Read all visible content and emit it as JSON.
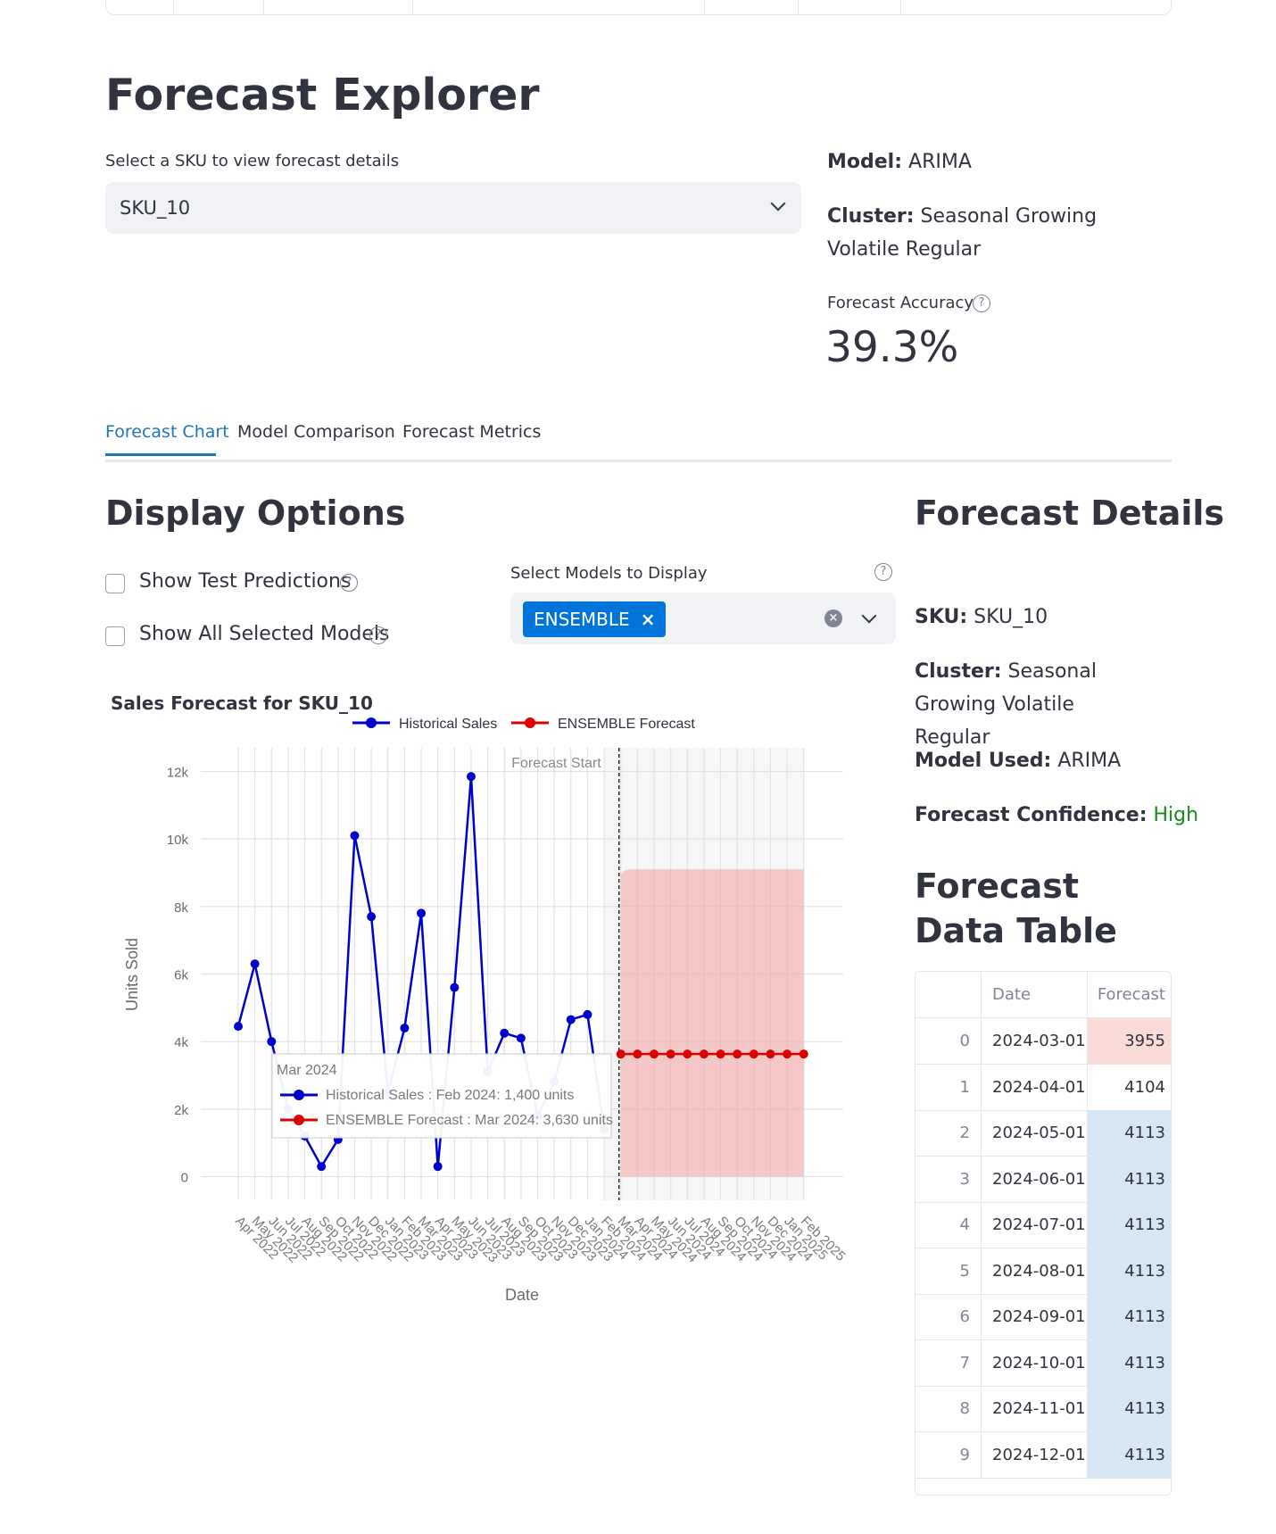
{
  "page": {
    "title": "Forecast Explorer"
  },
  "sku_select": {
    "label": "Select a SKU to view forecast details",
    "value": "SKU_10"
  },
  "summary": {
    "model_label": "Model:",
    "model_value": "ARIMA",
    "cluster_label": "Cluster:",
    "cluster_value": "Seasonal Growing Volatile Regular",
    "accuracy_label": "Forecast Accuracy",
    "accuracy_value": "39.3%"
  },
  "tabs": [
    {
      "label": "Forecast Chart",
      "active": true
    },
    {
      "label": "Model Comparison",
      "active": false
    },
    {
      "label": "Forecast Metrics",
      "active": false
    }
  ],
  "display_options": {
    "heading": "Display Options",
    "show_test_predictions": {
      "label": "Show Test Predictions",
      "checked": false
    },
    "show_all_models": {
      "label": "Show All Selected Models",
      "checked": false
    },
    "models_label": "Select Models to Display",
    "selected_models": [
      "ENSEMBLE"
    ]
  },
  "details": {
    "heading": "Forecast Details",
    "sku_label": "SKU:",
    "sku_value": "SKU_10",
    "cluster_label": "Cluster:",
    "cluster_value": "Seasonal Growing Volatile Regular",
    "model_label": "Model Used:",
    "model_value": "ARIMA",
    "confidence_label": "Forecast Confidence:",
    "confidence_value": "High",
    "confidence_color": "#1a8a1a"
  },
  "data_table": {
    "heading": "Forecast Data Table",
    "columns": [
      "",
      "Date",
      "Forecast"
    ],
    "rows": [
      {
        "index": "0",
        "date": "2024-03-01",
        "forecast": "3955"
      },
      {
        "index": "1",
        "date": "2024-04-01",
        "forecast": "4104"
      },
      {
        "index": "2",
        "date": "2024-05-01",
        "forecast": "4113"
      },
      {
        "index": "3",
        "date": "2024-06-01",
        "forecast": "4113"
      },
      {
        "index": "4",
        "date": "2024-07-01",
        "forecast": "4113"
      },
      {
        "index": "5",
        "date": "2024-08-01",
        "forecast": "4113"
      },
      {
        "index": "6",
        "date": "2024-09-01",
        "forecast": "4113"
      },
      {
        "index": "7",
        "date": "2024-10-01",
        "forecast": "4113"
      },
      {
        "index": "8",
        "date": "2024-11-01",
        "forecast": "4113"
      },
      {
        "index": "9",
        "date": "2024-12-01",
        "forecast": "4113"
      }
    ],
    "colors": {
      "low": "#fadbd8",
      "mid": "#ffffff",
      "high": "#d6e6f4"
    }
  },
  "chart_data": {
    "type": "line",
    "title": "Sales Forecast for SKU_10",
    "xlabel": "Date",
    "ylabel": "Units Sold",
    "ylim": [
      -700,
      12700
    ],
    "yticks": [
      0,
      2000,
      4000,
      6000,
      8000,
      10000,
      12000
    ],
    "ytick_labels": [
      "0",
      "2k",
      "4k",
      "6k",
      "8k",
      "10k",
      "12k"
    ],
    "x": [
      "Apr 2022",
      "May 2022",
      "Jun 2022",
      "Jul 2022",
      "Aug 2022",
      "Sep 2022",
      "Oct 2022",
      "Nov 2022",
      "Dec 2022",
      "Jan 2023",
      "Feb 2023",
      "Mar 2023",
      "Apr 2023",
      "May 2023",
      "Jun 2023",
      "Jul 2023",
      "Aug 2023",
      "Sep 2023",
      "Oct 2023",
      "Nov 2023",
      "Dec 2023",
      "Jan 2024",
      "Feb 2024",
      "Mar 2024",
      "Apr 2024",
      "May 2024",
      "Jun 2024",
      "Jul 2024",
      "Aug 2024",
      "Sep 2024",
      "Oct 2024",
      "Nov 2024",
      "Dec 2024",
      "Jan 2025",
      "Feb 2025"
    ],
    "series": [
      {
        "name": "Historical Sales",
        "color": "#0000cc",
        "values": [
          4450,
          6300,
          4000,
          2000,
          1200,
          300,
          1100,
          10100,
          7700,
          2500,
          4400,
          7800,
          300,
          5600,
          11850,
          3100,
          4250,
          4100,
          1800,
          2800,
          4650,
          4800,
          1400,
          null,
          null,
          null,
          null,
          null,
          null,
          null,
          null,
          null,
          null,
          null,
          null
        ]
      },
      {
        "name": "ENSEMBLE Forecast",
        "color": "#dd0000",
        "values": [
          null,
          null,
          null,
          null,
          null,
          null,
          null,
          null,
          null,
          null,
          null,
          null,
          null,
          null,
          null,
          null,
          null,
          null,
          null,
          null,
          null,
          null,
          null,
          3630,
          3630,
          3630,
          3630,
          3630,
          3630,
          3630,
          3630,
          3630,
          3630,
          3630,
          3630
        ]
      }
    ],
    "confidence_band": {
      "start": "Mar 2024",
      "end": "Feb 2025",
      "lower": 0,
      "upper": 9100,
      "color": "#f4a6a6"
    },
    "forecast_start": {
      "x": "Mar 2024",
      "label": "Forecast Start"
    },
    "tooltip": {
      "title": "Mar 2024",
      "lines": [
        "Historical Sales : Feb 2024: 1,400 units",
        "ENSEMBLE Forecast : Mar 2024: 3,630 units"
      ]
    },
    "legend_position": "top",
    "grid": true
  }
}
